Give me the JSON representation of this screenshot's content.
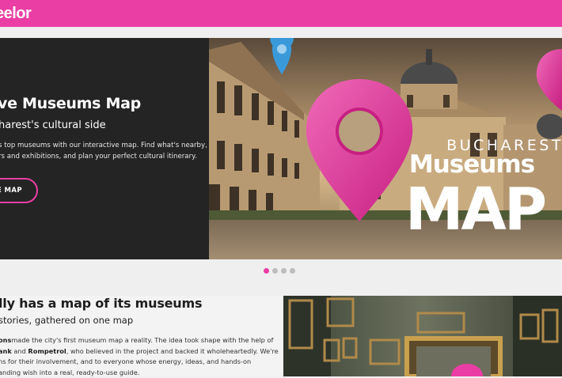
{
  "header": {
    "brand": "eelor"
  },
  "hero": {
    "title": "ve Museums Map",
    "subtitle": "harest's cultural side",
    "description_lines": [
      "s top museums with our interactive map. Find what's nearby,",
      "rs and exhibitions, and plan your perfect cultural itinerary."
    ],
    "cta_label": "E MAP",
    "poster": {
      "line1": "BUCHAREST",
      "line2": "Museums",
      "line3": "MAP"
    }
  },
  "carousel": {
    "dot_count": 4,
    "active_index": 0
  },
  "section": {
    "title": "lly has a map of its museums",
    "subtitle": "stories, gathered on one map",
    "paragraph": {
      "line1_start": "ons",
      "line1_rest": "made the city's first museum map a reality. The idea took shape with the help of",
      "line2_bold1": "ank",
      "line2_and": " and ",
      "line2_bold2": "Rompetrol",
      "line2_rest": ", who believed in the project and backed it wholeheartedly. We're",
      "line3": "ns for their involvement, and to everyone whose energy, ideas, and hands-on",
      "line4": "anding wish into a real, ready-to-use guide."
    }
  },
  "colors": {
    "accent": "#ea3ea4",
    "pin_secondary": "#3a9ad9",
    "dark_panel": "#242424"
  }
}
